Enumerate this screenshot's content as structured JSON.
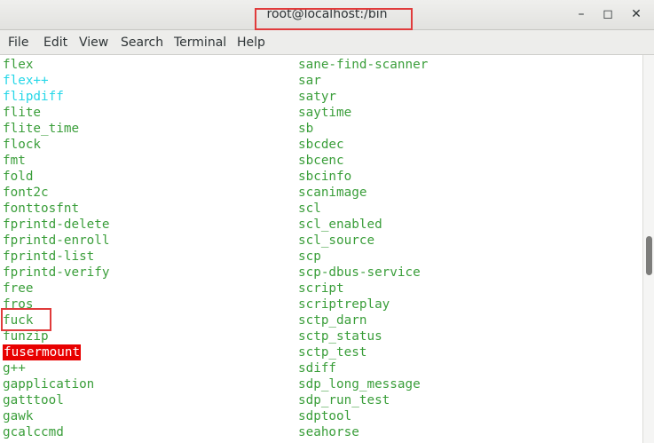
{
  "window": {
    "title": "root@localhost:/bin"
  },
  "controls": {
    "minimize": "–",
    "maximize": "◻",
    "close": "✕"
  },
  "menu": [
    "File",
    "Edit",
    "View",
    "Search",
    "Terminal",
    "Help"
  ],
  "colors": {
    "text": "#3a9e3a",
    "symlink": "#26d7e8",
    "highlight_bg": "#e80000",
    "annotation": "#e03b3b"
  },
  "left_column": [
    {
      "name": "flex",
      "style": "green"
    },
    {
      "name": "flex++",
      "style": "cyan"
    },
    {
      "name": "flipdiff",
      "style": "cyan"
    },
    {
      "name": "flite",
      "style": "green"
    },
    {
      "name": "flite_time",
      "style": "green"
    },
    {
      "name": "flock",
      "style": "green"
    },
    {
      "name": "fmt",
      "style": "green"
    },
    {
      "name": "fold",
      "style": "green"
    },
    {
      "name": "font2c",
      "style": "green"
    },
    {
      "name": "fonttosfnt",
      "style": "green"
    },
    {
      "name": "fprintd-delete",
      "style": "green"
    },
    {
      "name": "fprintd-enroll",
      "style": "green"
    },
    {
      "name": "fprintd-list",
      "style": "green"
    },
    {
      "name": "fprintd-verify",
      "style": "green"
    },
    {
      "name": "free",
      "style": "green"
    },
    {
      "name": "fros",
      "style": "green"
    },
    {
      "name": "fuck",
      "style": "green"
    },
    {
      "name": "funzip",
      "style": "green"
    },
    {
      "name": "fusermount",
      "style": "hl"
    },
    {
      "name": "g++",
      "style": "green"
    },
    {
      "name": "gapplication",
      "style": "green"
    },
    {
      "name": "gatttool",
      "style": "green"
    },
    {
      "name": "gawk",
      "style": "green"
    },
    {
      "name": "gcalccmd",
      "style": "green"
    }
  ],
  "right_column": [
    "sane-find-scanner",
    "sar",
    "satyr",
    "saytime",
    "sb",
    "sbcdec",
    "sbcenc",
    "sbcinfo",
    "scanimage",
    "scl",
    "scl_enabled",
    "scl_source",
    "scp",
    "scp-dbus-service",
    "script",
    "scriptreplay",
    "sctp_darn",
    "sctp_status",
    "sctp_test",
    "sdiff",
    "sdp_long_message",
    "sdp_run_test",
    "sdptool",
    "seahorse"
  ]
}
